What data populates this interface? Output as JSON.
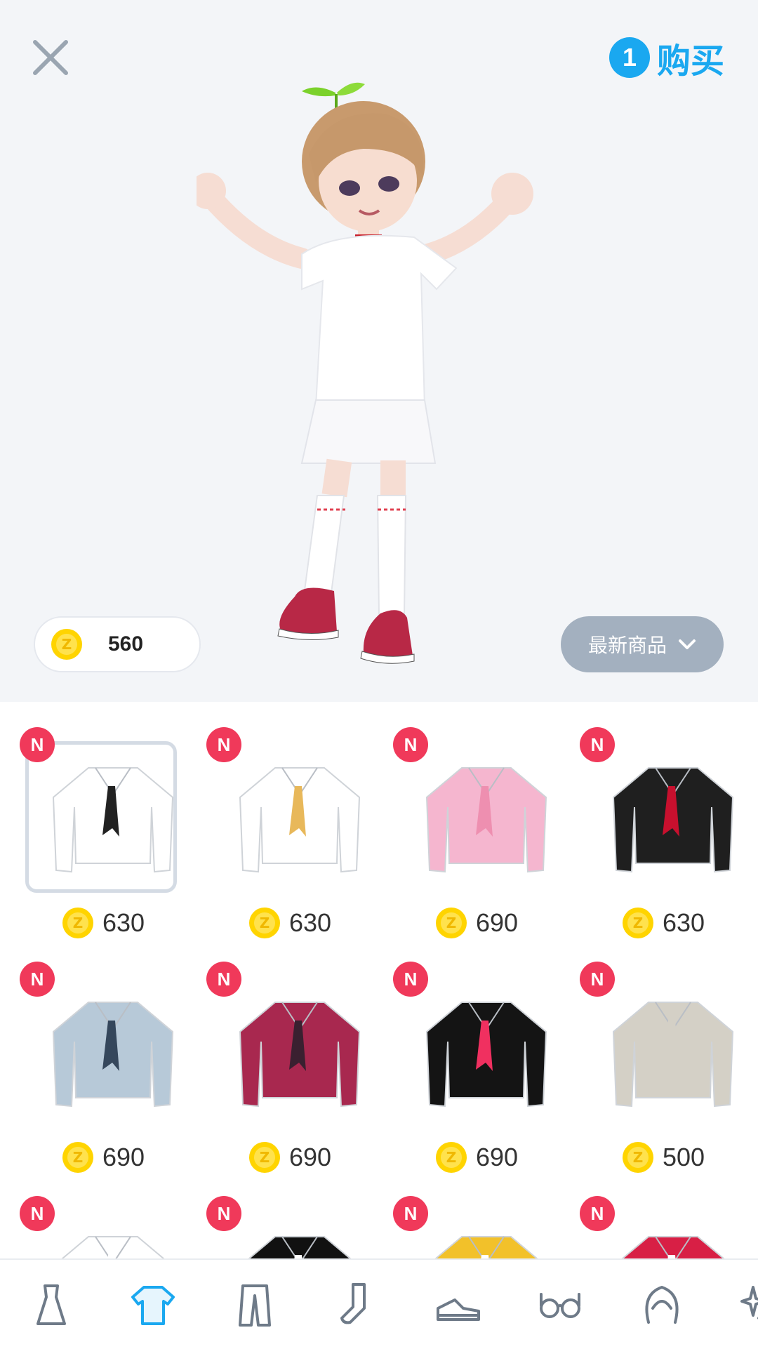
{
  "header": {
    "cart_count": "1",
    "buy_label": "购买"
  },
  "wallet": {
    "balance": "560"
  },
  "sort": {
    "label": "最新商品"
  },
  "badge_label": "N",
  "items": [
    {
      "price": "630",
      "color": "#ffffff",
      "tie": "#222222",
      "selected": true
    },
    {
      "price": "630",
      "color": "#ffffff",
      "tie": "#e8b85a"
    },
    {
      "price": "690",
      "color": "#f5b6cf",
      "tie": "#ee8fb0"
    },
    {
      "price": "630",
      "color": "#1f1f1f",
      "tie": "#c8102e"
    },
    {
      "price": "690",
      "color": "#b7c9d8",
      "tie": "#35475c"
    },
    {
      "price": "690",
      "color": "#a8284f",
      "tie": "#3a2030"
    },
    {
      "price": "690",
      "color": "#141414",
      "tie": "#f03060"
    },
    {
      "price": "500",
      "color": "#d4d0c6",
      "tie": "#d4d0c6"
    },
    {
      "price": "",
      "color": "#ffffff",
      "tie": "#ffffff"
    },
    {
      "price": "",
      "color": "#111111",
      "tie": "#ffffff"
    },
    {
      "price": "",
      "color": "#f2c12a",
      "tie": "#ffffff"
    },
    {
      "price": "",
      "color": "#d81f45",
      "tie": "#ffffff"
    }
  ],
  "tabs": [
    {
      "icon": "dress-icon",
      "active": false
    },
    {
      "icon": "tshirt-icon",
      "active": true
    },
    {
      "icon": "pants-icon",
      "active": false
    },
    {
      "icon": "sock-icon",
      "active": false
    },
    {
      "icon": "sneaker-icon",
      "active": false
    },
    {
      "icon": "glasses-icon",
      "active": false
    },
    {
      "icon": "hair-icon",
      "active": false
    },
    {
      "icon": "sparkle-icon",
      "active": false
    }
  ],
  "colors": {
    "accent": "#1aa8f0",
    "badge": "#f0395a",
    "coin": "#ffd400",
    "tab_inactive": "#6e7a88"
  }
}
